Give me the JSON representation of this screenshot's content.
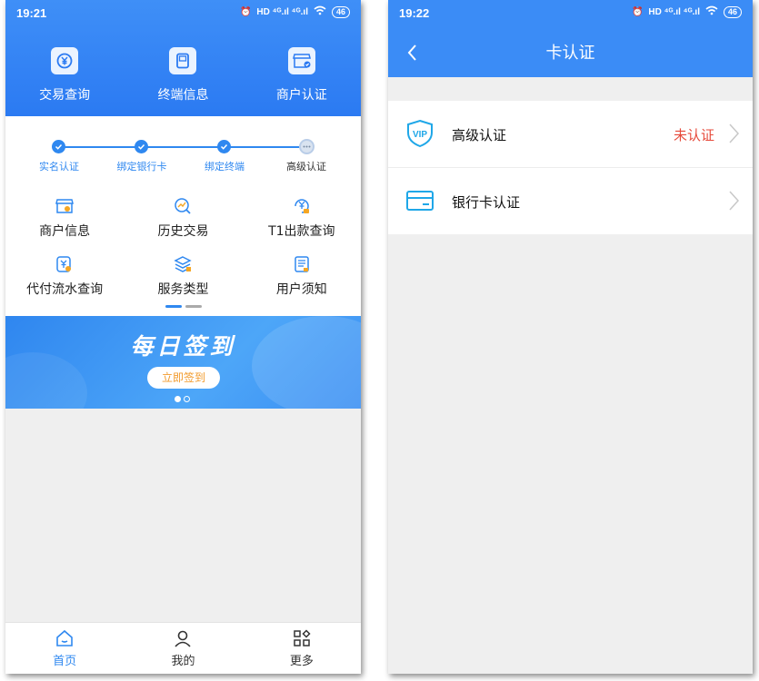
{
  "left": {
    "status": {
      "time": "19:21",
      "signal": "HD ⁴ᴳ.ıl ⁴ᴳ.ıl",
      "battery": "46"
    },
    "top_actions": [
      {
        "label": "交易查询",
        "icon": "yuan-search-icon"
      },
      {
        "label": "终端信息",
        "icon": "terminal-icon"
      },
      {
        "label": "商户认证",
        "icon": "store-verify-icon"
      }
    ],
    "steps": [
      {
        "label": "实名认证",
        "done": true
      },
      {
        "label": "绑定银行卡",
        "done": true
      },
      {
        "label": "绑定终端",
        "done": true
      },
      {
        "label": "高级认证",
        "done": false
      }
    ],
    "grid": [
      {
        "label": "商户信息",
        "icon": "store-icon"
      },
      {
        "label": "历史交易",
        "icon": "history-chart-icon"
      },
      {
        "label": "T1出款查询",
        "icon": "withdraw-icon"
      },
      {
        "label": "代付流水查询",
        "icon": "payment-flow-icon"
      },
      {
        "label": "服务类型",
        "icon": "service-layers-icon"
      },
      {
        "label": "用户须知",
        "icon": "notice-icon"
      }
    ],
    "banner": {
      "title": "每日签到",
      "button": "立即签到"
    },
    "bottom_nav": [
      {
        "label": "首页",
        "icon": "home-icon",
        "active": true
      },
      {
        "label": "我的",
        "icon": "user-icon",
        "active": false
      },
      {
        "label": "更多",
        "icon": "more-grid-icon",
        "active": false
      }
    ]
  },
  "right": {
    "status": {
      "time": "19:22",
      "signal": "HD ⁴ᴳ.ıl ⁴ᴳ.ıl",
      "battery": "46"
    },
    "title": "卡认证",
    "rows": [
      {
        "label": "高级认证",
        "status": "未认证",
        "icon": "vip-shield-icon"
      },
      {
        "label": "银行卡认证",
        "status": "",
        "icon": "bank-card-icon"
      }
    ]
  },
  "colors": {
    "primary": "#2f88f0",
    "alert": "#e64a3b",
    "banner_button_text": "#f29b2c"
  }
}
